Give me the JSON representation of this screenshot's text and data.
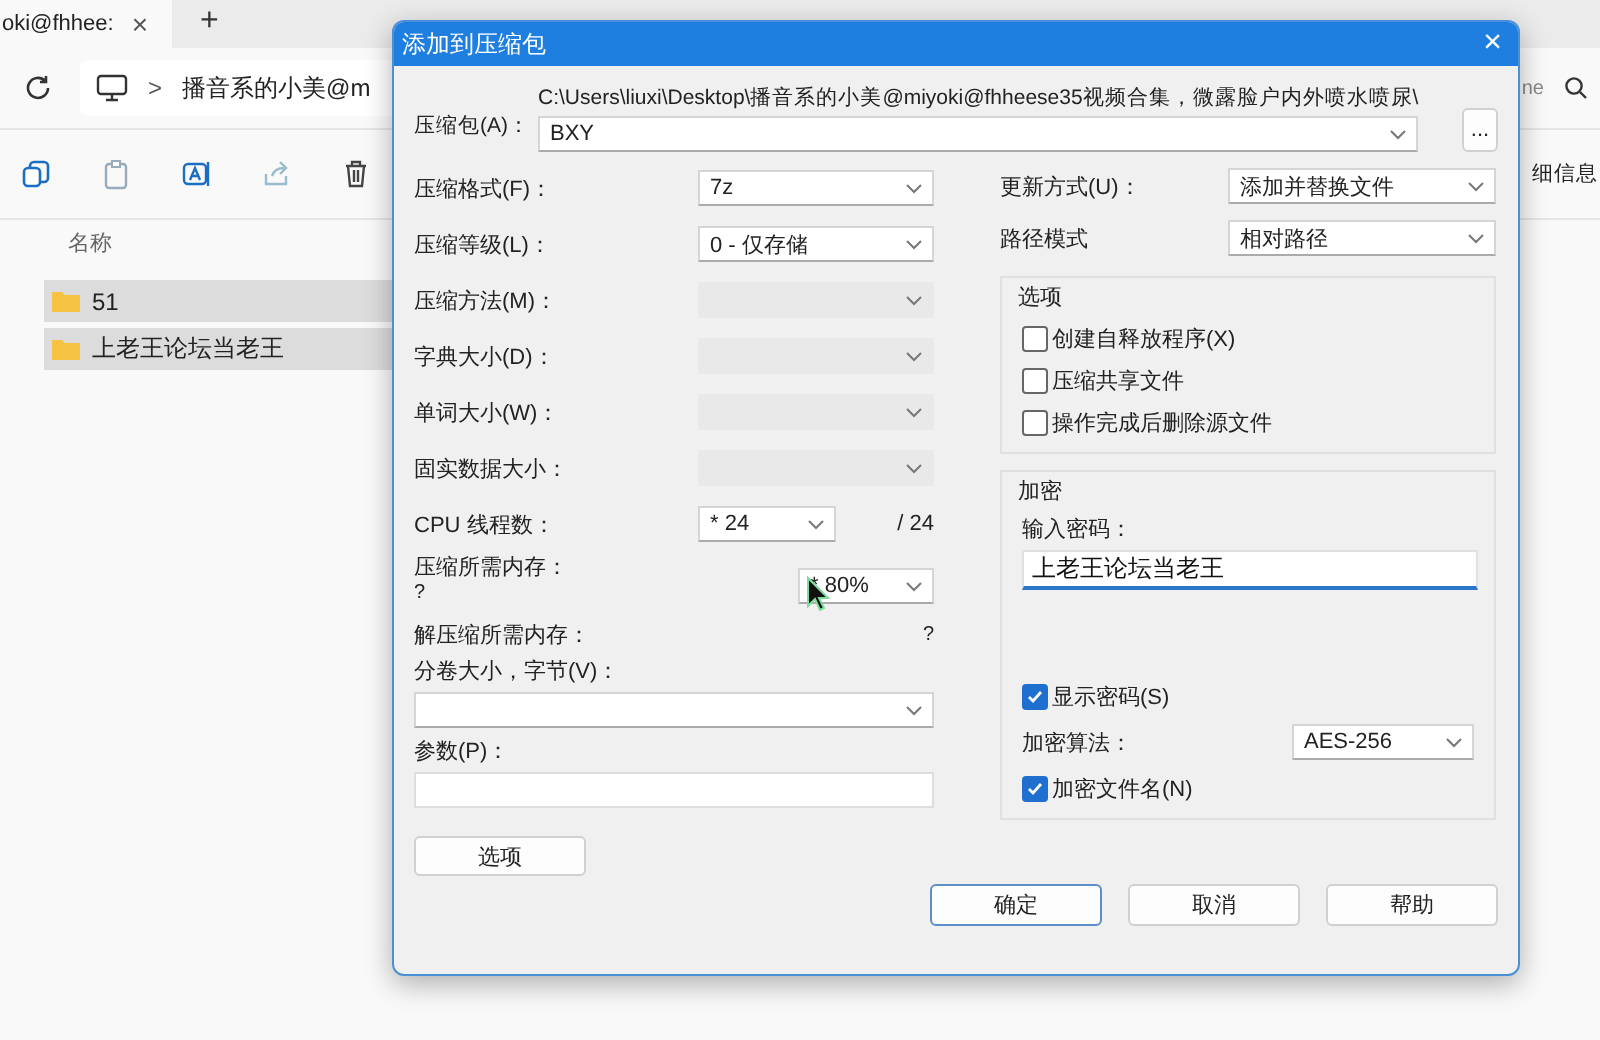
{
  "explorer": {
    "tab_title": "oki@fhhee:",
    "tab_close": "×",
    "new_tab": "+",
    "breadcrumb_sep": ">",
    "address": "播音系的小美@m",
    "search_hint": "ne",
    "details": "细信息",
    "column_name": "名称",
    "files": [
      {
        "name": "51",
        "selected": true
      },
      {
        "name": "上老王论坛当老王",
        "selected": true
      }
    ]
  },
  "dialog": {
    "title": "添加到压缩包",
    "close": "×",
    "archive_label": "压缩包(A)：",
    "archive_path": "C:\\Users\\liuxi\\Desktop\\播音系的小美@miyoki@fhheese35视频合集，微露脸户内外喷水喷尿\\",
    "archive_name": "BXY",
    "browse": "...",
    "left_rows": [
      {
        "kind": "combo",
        "label": "压缩格式(F)：",
        "value": "7z",
        "disabled": false
      },
      {
        "kind": "combo",
        "label": "压缩等级(L)：",
        "value": "0 - 仅存储",
        "disabled": false
      },
      {
        "kind": "combo",
        "label": "压缩方法(M)：",
        "disabled": true
      },
      {
        "kind": "combo",
        "label": "字典大小(D)：",
        "disabled": true
      },
      {
        "kind": "combo",
        "label": "单词大小(W)：",
        "disabled": true
      },
      {
        "kind": "combo",
        "label": "固实数据大小：",
        "disabled": true
      },
      {
        "kind": "threads",
        "label": "CPU 线程数：",
        "value": "* 24",
        "suffix": "/ 24"
      },
      {
        "kind": "memory",
        "label": "压缩所需内存：",
        "note": "?",
        "value": "* 80%"
      },
      {
        "kind": "info",
        "label": "解压缩所需内存：",
        "note": "?"
      },
      {
        "kind": "wide-combo",
        "label": "分卷大小，字节(V)："
      },
      {
        "kind": "wide-input",
        "label": "参数(P)："
      }
    ],
    "options_button": "选项",
    "update": {
      "label": "更新方式(U)：",
      "value": "添加并替换文件"
    },
    "path_mode": {
      "label": "路径模式",
      "value": "相对路径"
    },
    "options_group": {
      "title": "选项",
      "checkboxes": [
        {
          "label": "创建自释放程序(X)",
          "checked": false
        },
        {
          "label": "压缩共享文件",
          "checked": false
        },
        {
          "label": "操作完成后删除源文件",
          "checked": false
        }
      ]
    },
    "encryption": {
      "title": "加密",
      "password_label": "输入密码：",
      "password": "上老王论坛当老王",
      "show_password": {
        "label": "显示密码(S)",
        "checked": true
      },
      "method_label": "加密算法：",
      "method": "AES-256",
      "encrypt_names": {
        "label": "加密文件名(N)",
        "checked": true
      }
    },
    "buttons": [
      {
        "label": "确定",
        "focused": true
      },
      {
        "label": "取消",
        "focused": false
      },
      {
        "label": "帮助",
        "focused": false
      }
    ]
  }
}
